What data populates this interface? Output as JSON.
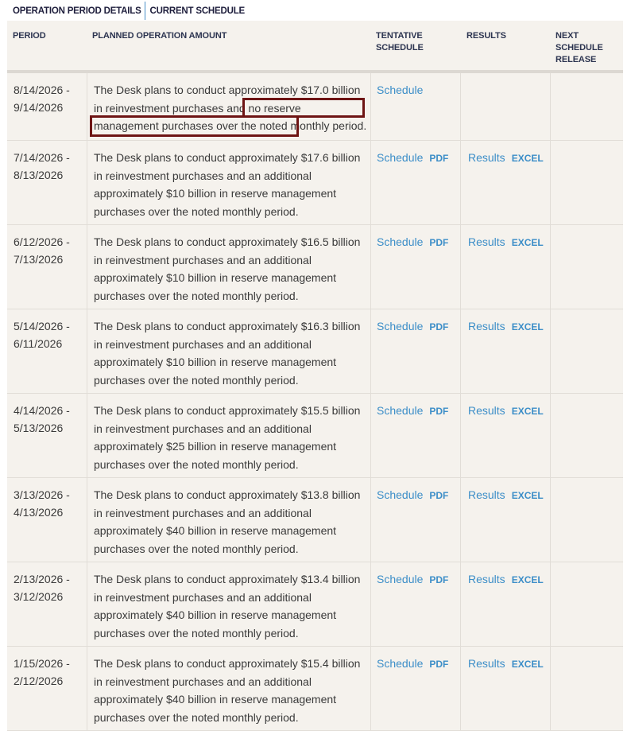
{
  "tabs": [
    {
      "label": "OPERATION PERIOD DETAILS",
      "active": true
    },
    {
      "label": "CURRENT SCHEDULE",
      "active": false
    }
  ],
  "columns": {
    "period": "PERIOD",
    "amount": "PLANNED OPERATION AMOUNT",
    "tentative": "TENTATIVE SCHEDULE",
    "results": "RESULTS",
    "next": "NEXT SCHEDULE RELEASE"
  },
  "link_labels": {
    "schedule": "Schedule",
    "pdf": "PDF",
    "results": "Results",
    "excel": "EXCEL"
  },
  "rows": [
    {
      "period_start": "8/14/2026 -",
      "period_end": "9/14/2026",
      "amount_text": "The Desk plans to conduct approximately $17.0 billion in reinvestment purchases and no reserve management purchases over the noted monthly period.",
      "highlight": "no reserve management purchases over the noted monthly period.",
      "has_pdf": false,
      "has_results": false
    },
    {
      "period_start": "7/14/2026 -",
      "period_end": "8/13/2026",
      "amount_text": "The Desk plans to conduct approximately $17.6 billion in reinvestment purchases and an additional approximately $10 billion in reserve management purchases over the noted monthly period.",
      "has_pdf": true,
      "has_results": true
    },
    {
      "period_start": "6/12/2026 -",
      "period_end": "7/13/2026",
      "amount_text": "The Desk plans to conduct approximately $16.5 billion in reinvestment purchases and an additional approximately $10 billion in reserve management purchases over the noted monthly period.",
      "has_pdf": true,
      "has_results": true
    },
    {
      "period_start": "5/14/2026 -",
      "period_end": "6/11/2026",
      "amount_text": "The Desk plans to conduct approximately $16.3 billion in reinvestment purchases and an additional approximately $10 billion in reserve management purchases over the noted monthly period.",
      "has_pdf": true,
      "has_results": true
    },
    {
      "period_start": "4/14/2026 -",
      "period_end": "5/13/2026",
      "amount_text": "The Desk plans to conduct approximately $15.5 billion in reinvestment purchases and an additional approximately $25 billion in reserve management purchases over the noted monthly period.",
      "has_pdf": true,
      "has_results": true
    },
    {
      "period_start": "3/13/2026 -",
      "period_end": "4/13/2026",
      "amount_text": "The Desk plans to conduct approximately $13.8 billion in reinvestment purchases and an additional approximately $40 billion in reserve management purchases over the noted monthly period.",
      "has_pdf": true,
      "has_results": true
    },
    {
      "period_start": "2/13/2026 -",
      "period_end": "3/12/2026",
      "amount_text": "The Desk plans to conduct approximately $13.4 billion in reinvestment purchases and an additional approximately $40 billion in reserve management purchases over the noted monthly period.",
      "has_pdf": true,
      "has_results": true
    },
    {
      "period_start": "1/15/2026 -",
      "period_end": "2/12/2026",
      "amount_text": "The Desk plans to conduct approximately $15.4 billion in reinvestment purchases and an additional approximately $40 billion in reserve management purchases over the noted monthly period.",
      "has_pdf": true,
      "has_results": true
    }
  ],
  "colors": {
    "link": "#3c8ec8",
    "highlight_border": "#6e1414",
    "table_bg": "#f5f2ed",
    "header_text": "#2c3450"
  }
}
